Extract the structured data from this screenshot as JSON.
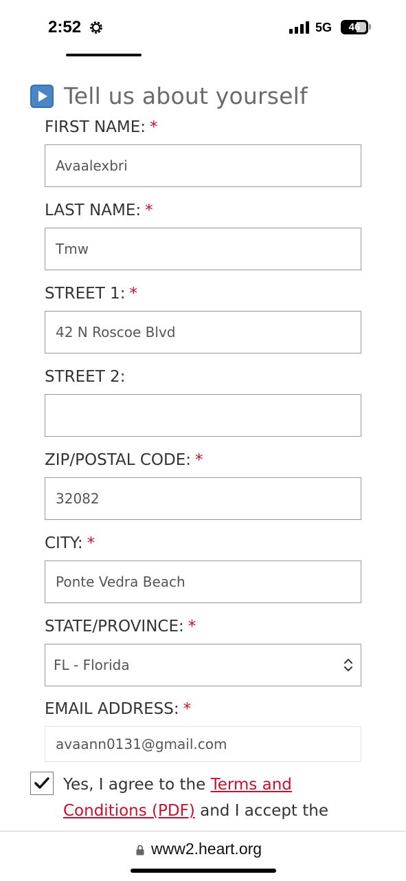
{
  "status_bar": {
    "time": "2:52",
    "network": "5G",
    "battery": "46"
  },
  "form": {
    "heading": "Tell us about yourself",
    "required_marker": "*",
    "fields": [
      {
        "label": "FIRST NAME:",
        "required": true,
        "value": "Avaalexbri"
      },
      {
        "label": "LAST NAME:",
        "required": true,
        "value": "Tmw"
      },
      {
        "label": "STREET 1:",
        "required": true,
        "value": "42 N Roscoe Blvd"
      },
      {
        "label": "STREET 2:",
        "required": false,
        "value": ""
      },
      {
        "label": "ZIP/POSTAL CODE:",
        "required": true,
        "value": "32082"
      },
      {
        "label": "CITY:",
        "required": true,
        "value": "Ponte Vedra Beach"
      },
      {
        "label": "STATE/PROVINCE:",
        "required": true,
        "value": "FL - Florida"
      },
      {
        "label": "EMAIL ADDRESS:",
        "required": true,
        "value": "avaann0131@gmail.com"
      }
    ],
    "agreement": {
      "checked": true,
      "text_before": "Yes, I agree to the ",
      "terms_link": "Terms and Conditions (PDF)",
      "text_after": " and I accept the"
    }
  },
  "browser": {
    "url": "www2.heart.org"
  },
  "colors": {
    "required": "#c8102e",
    "link": "#c8102e",
    "heading": "#6a6a6a",
    "play_icon": "#4a86c5"
  }
}
